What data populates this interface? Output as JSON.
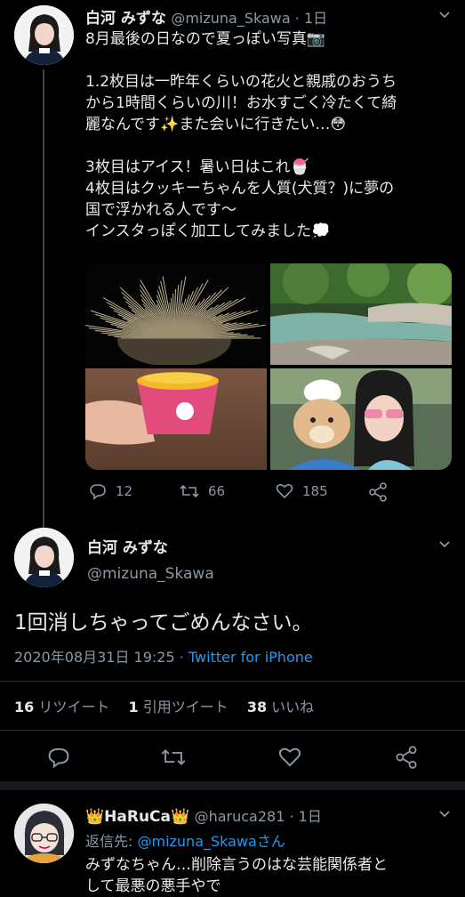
{
  "tweet1": {
    "name": "白河 みずな",
    "handle": "@mizuna_Skawa · 1日",
    "lines": [
      "8月最後の日なので夏っぽい写真📷",
      "",
      "1.2枚目は一昨年くらいの花火と親戚のおうち",
      "から1時間くらいの川！お水すごく冷たくて綺",
      "麗なんです✨また会いに行きたい…😳",
      "",
      "3枚目はアイス！暑い日はこれ🍧",
      "4枚目はクッキーちゃんを人質(犬質？)に夢の",
      "国で浮かれる人です〜",
      "インスタっぽく加工してみました💭"
    ],
    "replies": "12",
    "retweets": "66",
    "likes": "185"
  },
  "tweet2": {
    "name": "白河 みずな",
    "handle": "@mizuna_Skawa",
    "text": "1回消しちゃってごめんなさい。",
    "datetime": "2020年08月31日 19:25",
    "source": "· Twitter for iPhone",
    "rt_count": "16",
    "rt_label": "リツイート",
    "quote_count": "1",
    "quote_label": "引用ツイート",
    "like_count": "38",
    "like_label": "いいね"
  },
  "tweet3": {
    "name": "👑HaRuCa👑",
    "handle": "@haruca281 · 1日",
    "reply_prefix": "返信先: ",
    "reply_to": "@mizuna_Skawaさん",
    "text1": "みずなちゃん…削除言うのはな芸能関係者と",
    "text2": "して最悪の悪手やで"
  },
  "colors": {
    "accent": "#1d9bf0",
    "muted": "#8b98a5",
    "bg": "#000000"
  }
}
